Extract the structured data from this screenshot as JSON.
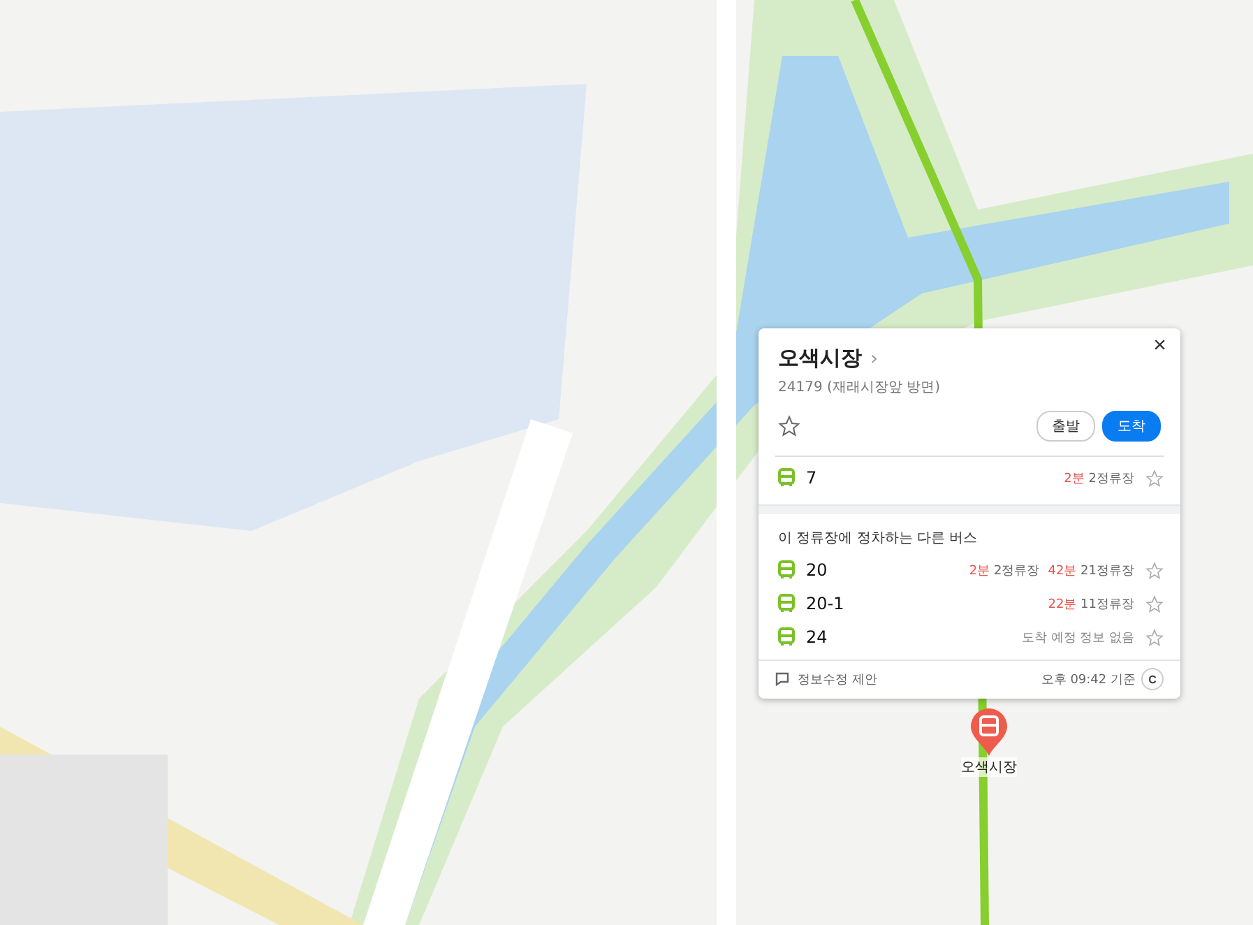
{
  "map": {
    "marker": {
      "label": "오색시장"
    }
  },
  "stop_popup": {
    "title": "오색시장",
    "title_arrow": "›",
    "subtitle": "24179 (재래시장앞 방면)",
    "close": "×",
    "favorite": false,
    "buttons": [
      {
        "label": "출발",
        "selected": false
      },
      {
        "label": "도착",
        "selected": true
      }
    ],
    "main_buses": [
      {
        "number": "7",
        "favorite": false,
        "arrivals": [
          {
            "kind": "eta",
            "time": "2분",
            "stops": "2정류장"
          }
        ]
      }
    ],
    "other_heading": "이 정류장에 정차하는 다른 버스",
    "other_buses": [
      {
        "number": "20",
        "favorite": false,
        "arrivals": [
          {
            "kind": "eta",
            "time": "2분",
            "stops": "2정류장"
          },
          {
            "kind": "eta",
            "time": "42분",
            "stops": "21정류장"
          }
        ]
      },
      {
        "number": "20-1",
        "favorite": false,
        "arrivals": [
          {
            "kind": "eta",
            "time": "22분",
            "stops": "11정류장"
          }
        ]
      },
      {
        "number": "24",
        "favorite": false,
        "arrivals": [
          {
            "kind": "none",
            "text": "도착 예정 정보 없음"
          }
        ]
      }
    ],
    "footer": {
      "suggest": "정보수정 제안",
      "updated": "오후 09:42 기준",
      "refresh": "C"
    }
  }
}
